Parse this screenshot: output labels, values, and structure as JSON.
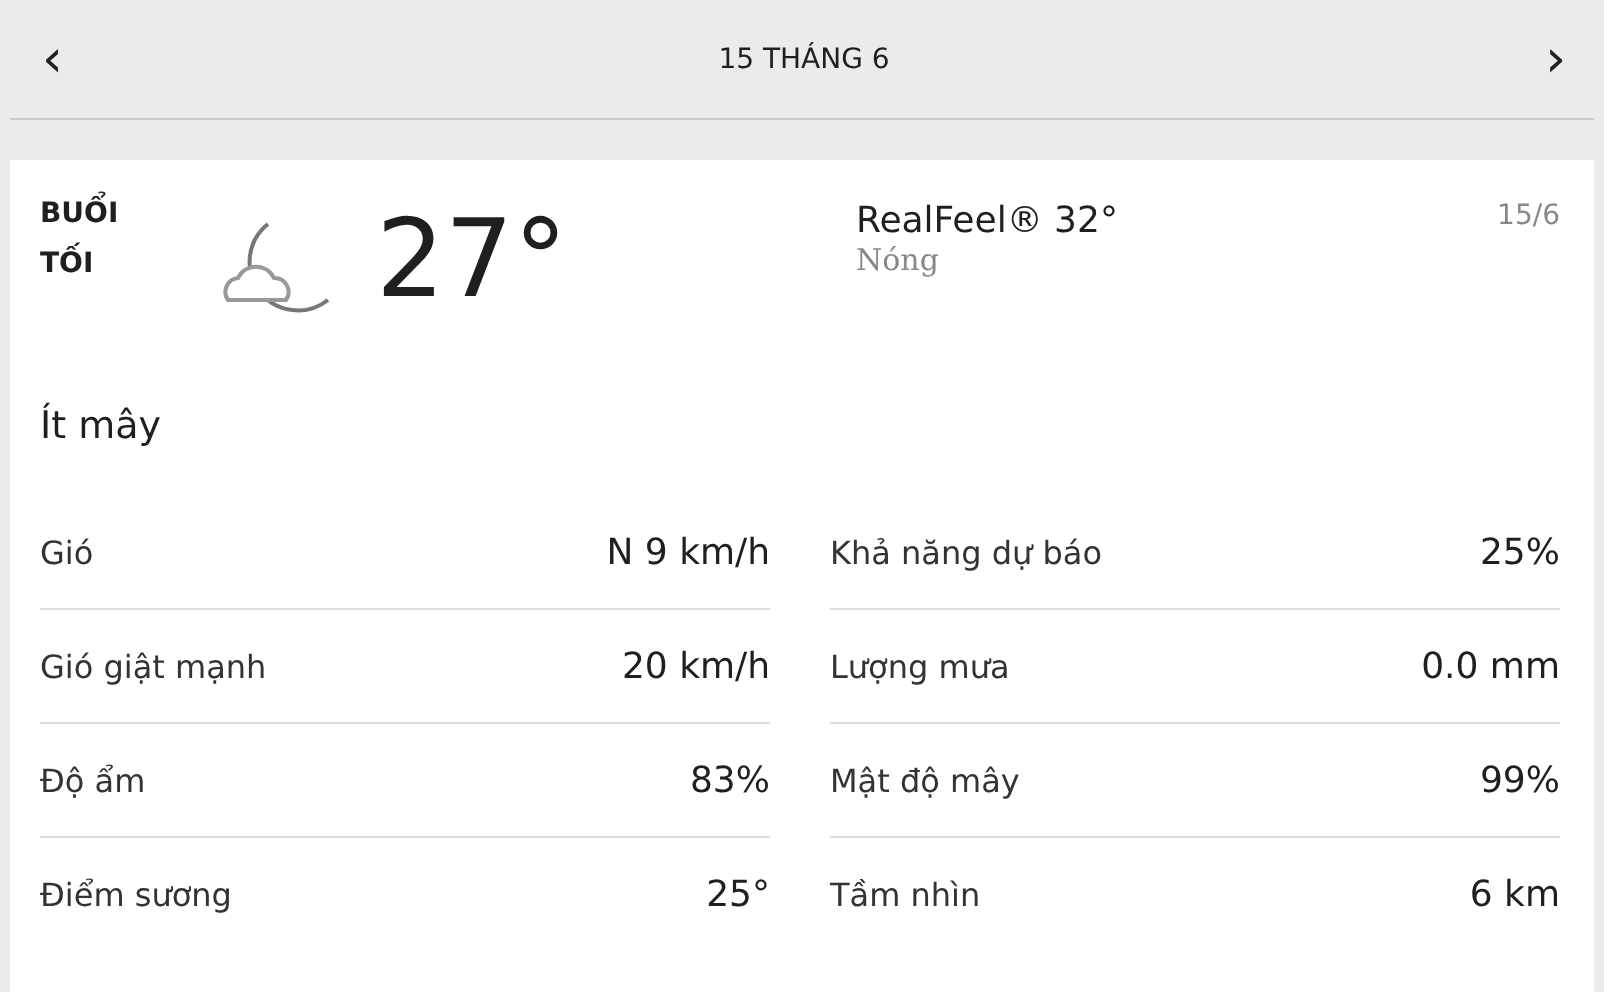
{
  "header": {
    "prev": "‹",
    "title": "15 THÁNG 6",
    "next": "›"
  },
  "card": {
    "period": "BUỔI TỐI",
    "temperature": "27°",
    "realfeel": "RealFeel® 32°",
    "realfeel_phrase": "Nóng",
    "date": "15/6",
    "condition": "Ít mây",
    "left_details": [
      {
        "label": "Gió",
        "value": "N 9 km/h"
      },
      {
        "label": "Gió giật mạnh",
        "value": "20 km/h"
      },
      {
        "label": "Độ ẩm",
        "value": "83%"
      },
      {
        "label": "Điểm sương",
        "value": "25°"
      }
    ],
    "right_details": [
      {
        "label": "Khả năng dự báo",
        "value": "25%"
      },
      {
        "label": "Lượng mưa",
        "value": "0.0 mm"
      },
      {
        "label": "Mật độ mây",
        "value": "99%"
      },
      {
        "label": "Tầm nhìn",
        "value": "6 km"
      }
    ]
  }
}
